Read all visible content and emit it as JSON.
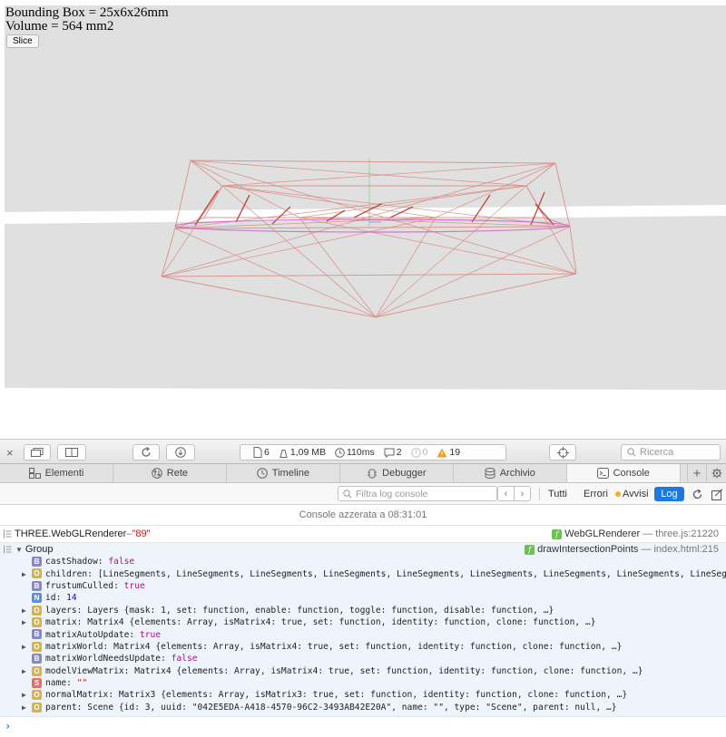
{
  "viewport": {
    "bounding_box_label": "Bounding Box = 25x6x26mm",
    "volume_label": "Volume = 564 mm2",
    "slice_button_label": "Slice"
  },
  "toolbar": {
    "activity": {
      "resources": "6",
      "size": "1,09 MB",
      "time": "110ms",
      "logs": "2",
      "errors": "0",
      "warnings": "19"
    },
    "search_placeholder": "Ricerca"
  },
  "tabs": [
    {
      "label": "Elementi",
      "icon": "elements-icon"
    },
    {
      "label": "Rete",
      "icon": "network-icon"
    },
    {
      "label": "Timeline",
      "icon": "timeline-icon"
    },
    {
      "label": "Debugger",
      "icon": "debugger-icon"
    },
    {
      "label": "Archivio",
      "icon": "storage-icon"
    },
    {
      "label": "Console",
      "icon": "console-icon",
      "active": true
    }
  ],
  "filter": {
    "placeholder": "Filtra log console",
    "all": "Tutti",
    "errors": "Errori",
    "warnings": "Avvisi",
    "log": "Log"
  },
  "console": {
    "cleared_message": "Console azzerata a 08:31:01",
    "renderer_line": {
      "name": "THREE.WebGLRenderer",
      "dash": " – ",
      "value": "\"89\"",
      "source_function": "WebGLRenderer",
      "source_location": "— three.js:21220"
    },
    "group": {
      "title": "Group",
      "source_function": "drawIntersectionPoints",
      "source_location": "— index.html:215",
      "properties": [
        {
          "key": "castShadow",
          "value": "false",
          "type": "B",
          "expandable": false
        },
        {
          "key": "children",
          "value": "[LineSegments, LineSegments, LineSegments, LineSegments, LineSegments, LineSegments, LineSegments, LineSegments, LineSegment",
          "type": "O",
          "expandable": true
        },
        {
          "key": "frustumCulled",
          "value": "true",
          "type": "B",
          "expandable": false
        },
        {
          "key": "id",
          "value": "14",
          "type": "N",
          "expandable": false
        },
        {
          "key": "layers",
          "value": "Layers {mask: 1, set: function, enable: function, toggle: function, disable: function, …}",
          "type": "O",
          "expandable": true
        },
        {
          "key": "matrix",
          "value": "Matrix4 {elements: Array, isMatrix4: true, set: function, identity: function, clone: function, …}",
          "type": "O",
          "expandable": true
        },
        {
          "key": "matrixAutoUpdate",
          "value": "true",
          "type": "B",
          "expandable": false
        },
        {
          "key": "matrixWorld",
          "value": "Matrix4 {elements: Array, isMatrix4: true, set: function, identity: function, clone: function, …}",
          "type": "O",
          "expandable": true
        },
        {
          "key": "matrixWorldNeedsUpdate",
          "value": "false",
          "type": "B",
          "expandable": false
        },
        {
          "key": "modelViewMatrix",
          "value": "Matrix4 {elements: Array, isMatrix4: true, set: function, identity: function, clone: function, …}",
          "type": "O",
          "expandable": true
        },
        {
          "key": "name",
          "value": "\"\"",
          "type": "S",
          "expandable": false
        },
        {
          "key": "normalMatrix",
          "value": "Matrix3 {elements: Array, isMatrix3: true, set: function, identity: function, clone: function, …}",
          "type": "O",
          "expandable": true
        },
        {
          "key": "parent",
          "value": "Scene {id: 3, uuid: \"042E5EDA-A418-4570-96C2-3493AB42E20A\", name: \"\", type: \"Scene\", parent: null, …}",
          "type": "O",
          "expandable": true
        }
      ]
    },
    "prompt": "›"
  },
  "colors": {
    "accent": "#1f78e0",
    "warning": "#f0a020",
    "wire": "#d98a80",
    "wire_dark": "#b8332b",
    "slice_plane": "#d15ad0"
  }
}
